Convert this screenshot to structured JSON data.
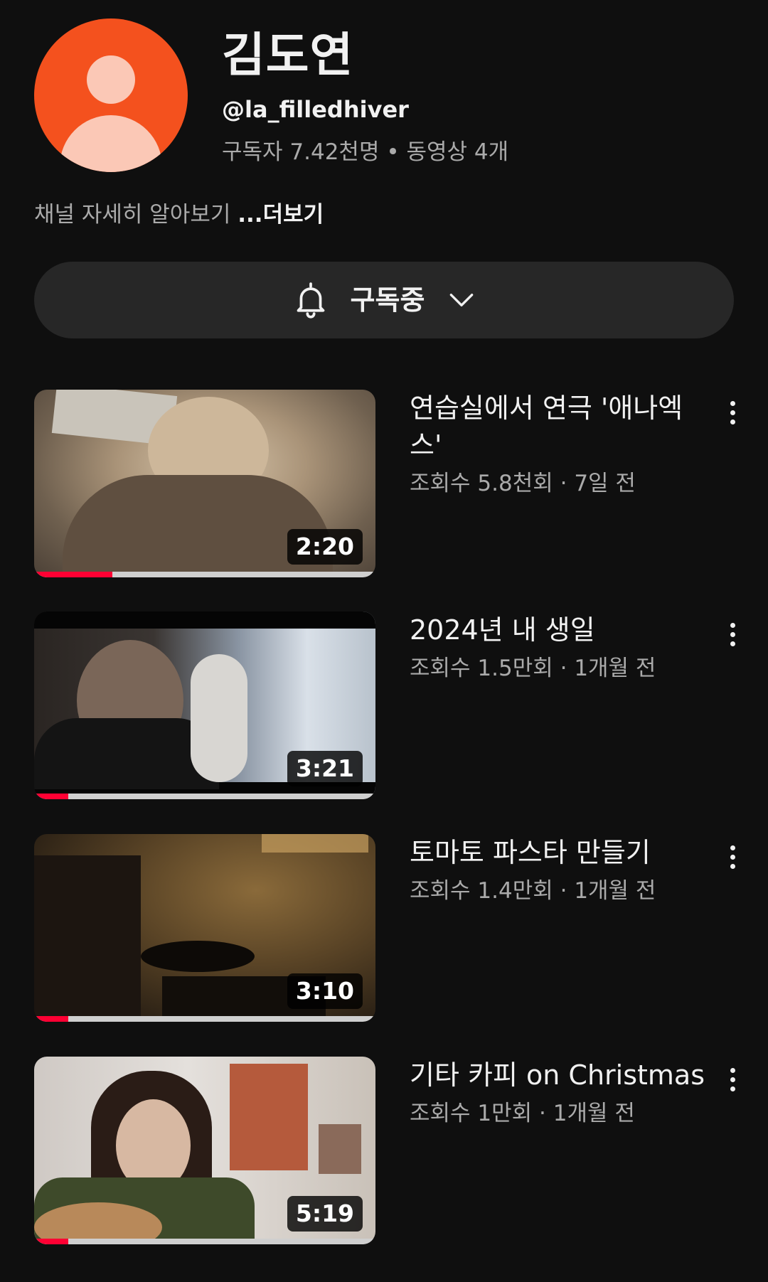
{
  "channel": {
    "name": "김도연",
    "handle": "@la_filledhiver",
    "stats": "구독자 7.42천명 • 동영상 4개",
    "description": "채널 자세히 알아보기 ",
    "more_label": "...더보기"
  },
  "subscribe": {
    "label": "구독중",
    "icon": "bell-icon",
    "dropdown_icon": "chevron-down-icon"
  },
  "colors": {
    "background": "#0f0f0f",
    "avatar": "#f4511e",
    "progress": "#ff0033"
  },
  "videos": [
    {
      "title": "연습실에서 연극 '애나엑스'",
      "meta": "조회수 5.8천회 · 7일 전",
      "duration": "2:20",
      "watched_fraction": 0.23
    },
    {
      "title": "2024년 내 생일",
      "meta": "조회수 1.5만회 · 1개월 전",
      "duration": "3:21",
      "watched_fraction": 0.1
    },
    {
      "title": "토마토 파스타 만들기",
      "meta": "조회수 1.4만회 · 1개월 전",
      "duration": "3:10",
      "watched_fraction": 0.1
    },
    {
      "title": "기타 카피 on Christmas",
      "meta": "조회수 1만회 · 1개월 전",
      "duration": "5:19",
      "watched_fraction": 0.1
    }
  ]
}
